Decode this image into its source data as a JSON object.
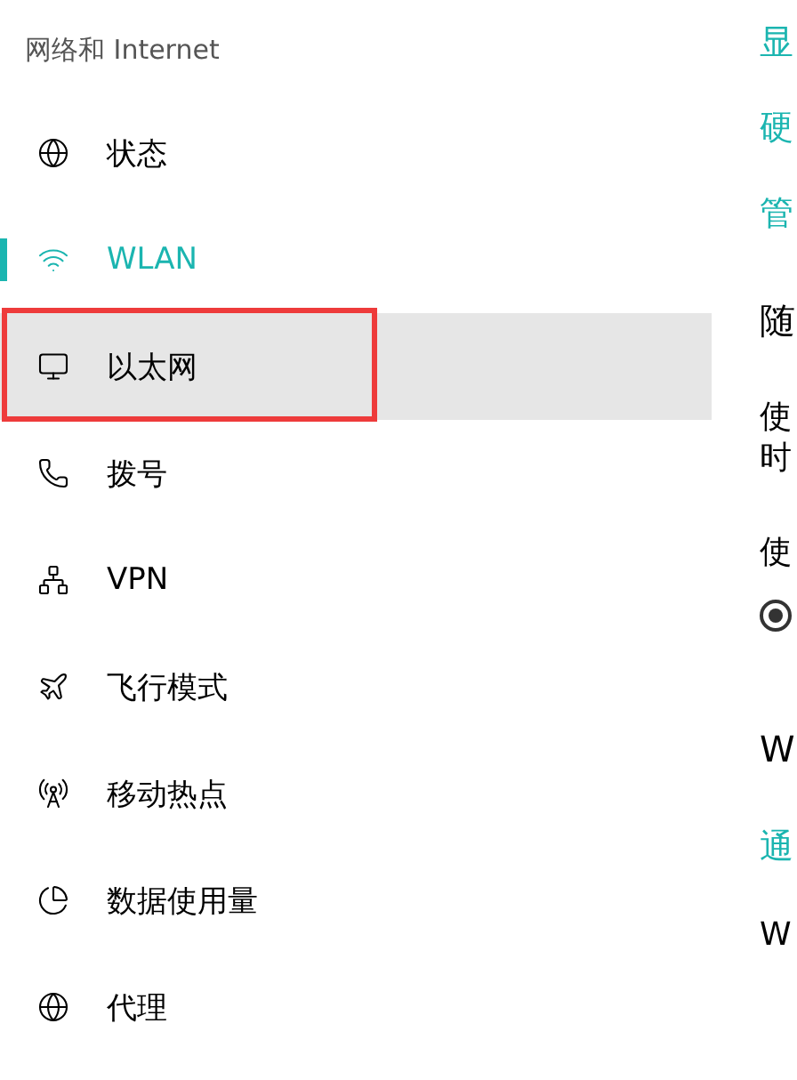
{
  "sidebar": {
    "title": "网络和 Internet",
    "items": [
      {
        "label": "状态",
        "selected": false,
        "hovered": false,
        "outlined": false
      },
      {
        "label": "WLAN",
        "selected": true,
        "hovered": false,
        "outlined": false
      },
      {
        "label": "以太网",
        "selected": false,
        "hovered": true,
        "outlined": true
      },
      {
        "label": "拨号",
        "selected": false,
        "hovered": false,
        "outlined": false
      },
      {
        "label": "VPN",
        "selected": false,
        "hovered": false,
        "outlined": false
      },
      {
        "label": "飞行模式",
        "selected": false,
        "hovered": false,
        "outlined": false
      },
      {
        "label": "移动热点",
        "selected": false,
        "hovered": false,
        "outlined": false
      },
      {
        "label": "数据使用量",
        "selected": false,
        "hovered": false,
        "outlined": false
      },
      {
        "label": "代理",
        "selected": false,
        "hovered": false,
        "outlined": false
      }
    ]
  },
  "content": {
    "links": [
      "显",
      "硬",
      "管"
    ],
    "random_section": {
      "heading": "随",
      "lines": [
        "使",
        "时"
      ],
      "option_label": "使",
      "radio": {
        "selected": true
      }
    },
    "second_section": {
      "heading": "W",
      "link": "通",
      "text": "W"
    }
  }
}
